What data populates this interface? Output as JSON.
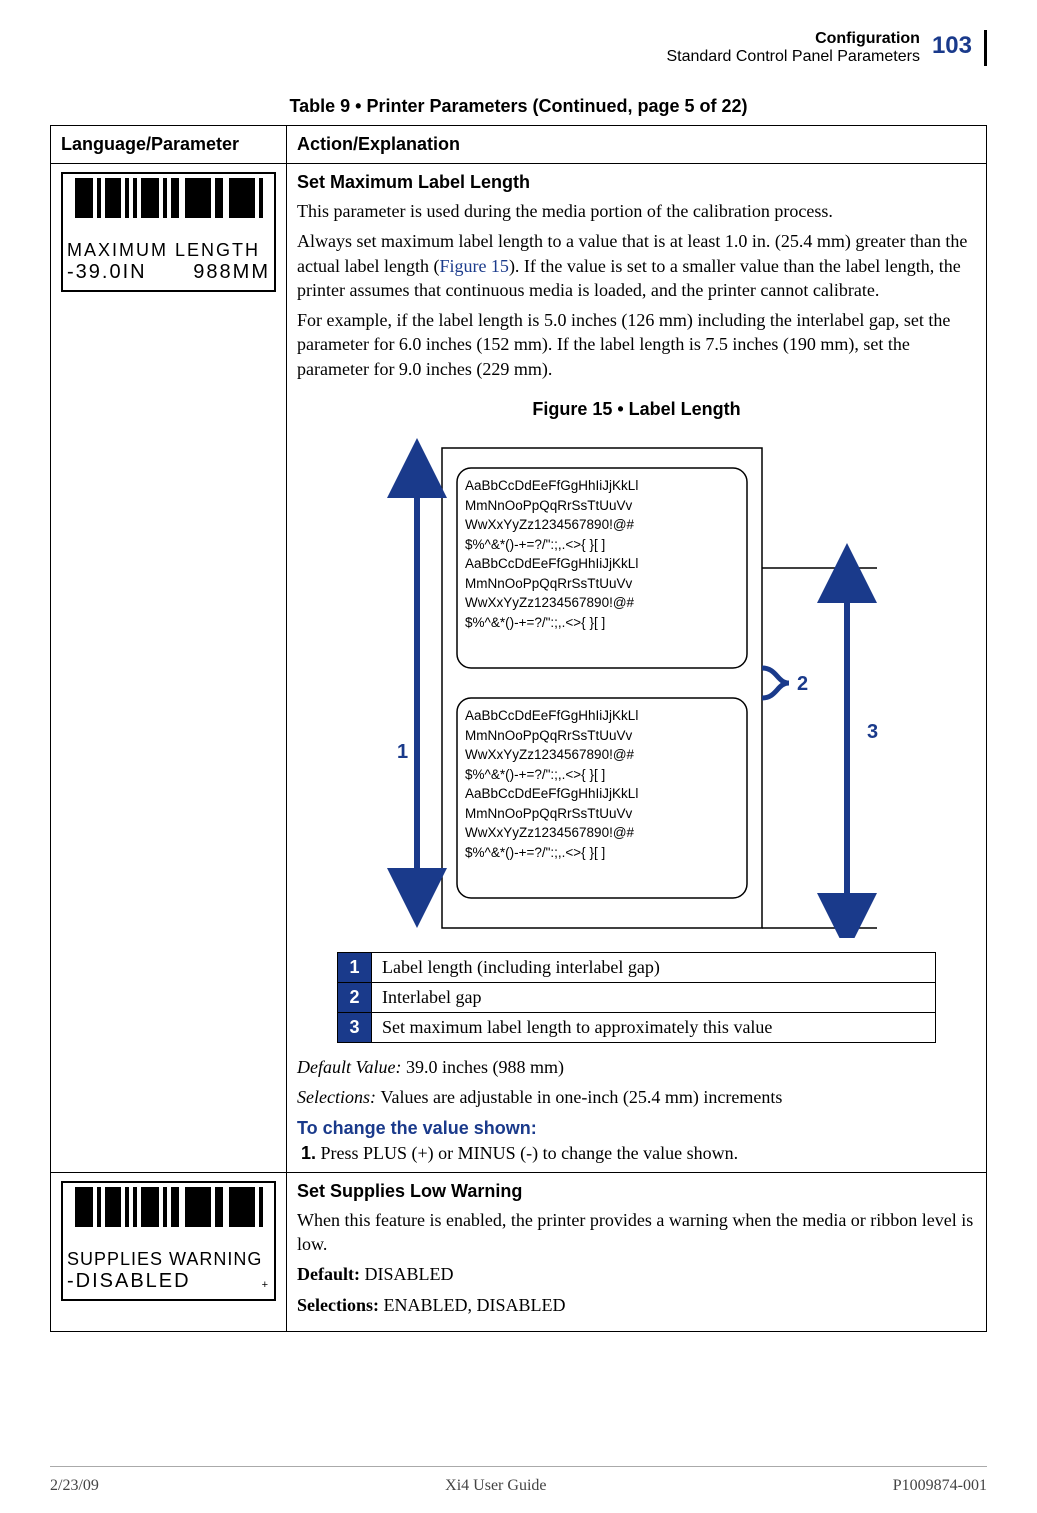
{
  "header": {
    "line1": "Configuration",
    "line2": "Standard Control Panel Parameters",
    "page_number": "103"
  },
  "table_caption": "Table 9 • Printer Parameters (Continued, page 5 of 22)",
  "columns": {
    "col1": "Language/Parameter",
    "col2": "Action/Explanation"
  },
  "row1": {
    "lcd_line1": "MAXIMUM LENGTH",
    "lcd_line2_left": "-39.0IN",
    "lcd_line2_right": "988MM",
    "title": "Set Maximum Label Length",
    "p1": "This parameter is used during the media portion of the calibration process.",
    "p2a": "Always set maximum label length to a value that is at least 1.0 in. (25.4 mm) greater than the actual label length (",
    "p2_link": "Figure 15",
    "p2b": "). If the value is set to a smaller value than the label length, the printer assumes that continuous media is loaded, and the printer cannot calibrate.",
    "p3": "For example, if the label length is 5.0 inches (126 mm) including the interlabel gap, set the parameter for 6.0 inches (152 mm). If the label length is 7.5 inches (190 mm), set the parameter for 9.0 inches (229 mm).",
    "figure_caption": "Figure 15 • Label Length",
    "figure_text": "AaBbCcDdEeFfGgHhIiJjKkLl\nMmNnOoPpQqRrSsTtUuVv\nWwXxYyZz1234567890!@#\n$%^&*()-+=?/\":;,.<>{ }[ ]\nAaBbCcDdEeFfGgHhIiJjKkLl\nMmNnOoPpQqRrSsTtUuVv\nWwXxYyZz1234567890!@#\n$%^&*()-+=?/\":;,.<>{ }[ ]",
    "legend": {
      "n1": "1",
      "t1": "Label length (including interlabel gap)",
      "n2": "2",
      "t2": "Interlabel gap",
      "n3": "3",
      "t3": "Set maximum label length to approximately this value"
    },
    "default_label": "Default Value: ",
    "default_value": "39.0 inches (988 mm)",
    "selections_label": "Selections: ",
    "selections_value": "Values are adjustable in one-inch (25.4 mm) increments",
    "change_heading": "To change the value shown:",
    "step1_num": "1.",
    "step1_text": "Press PLUS (+) or MINUS (-) to change the value shown."
  },
  "row2": {
    "lcd_line1": "SUPPLIES WARNING",
    "lcd_line2_left": "-DISABLED",
    "lcd_line2_right": "+",
    "title": "Set Supplies Low Warning",
    "p1": "When this feature is enabled, the printer provides a warning when the media or ribbon level is low.",
    "default_label": "Default: ",
    "default_value": "DISABLED",
    "selections_label": "Selections: ",
    "selections_value": "ENABLED, DISABLED"
  },
  "footer": {
    "left": "2/23/09",
    "center": "Xi4 User Guide",
    "right": "P1009874-001"
  }
}
